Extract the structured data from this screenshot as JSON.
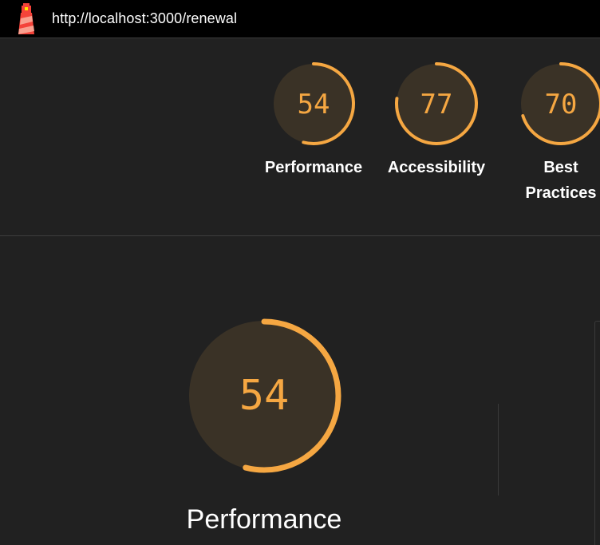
{
  "topbar": {
    "url": "http://localhost:3000/renewal"
  },
  "colors": {
    "average": "#f5a742",
    "gauge_fill": "#3a3226",
    "background": "#212121"
  },
  "gauges": [
    {
      "score": "54",
      "value": 54,
      "label": "Performance"
    },
    {
      "score": "77",
      "value": 77,
      "label": "Accessibility"
    },
    {
      "score": "70",
      "value": 70,
      "label": "Best Practices",
      "label_line1": "Best",
      "label_line2": "Practices"
    }
  ],
  "main": {
    "score": "54",
    "value": 54,
    "label": "Performance"
  }
}
